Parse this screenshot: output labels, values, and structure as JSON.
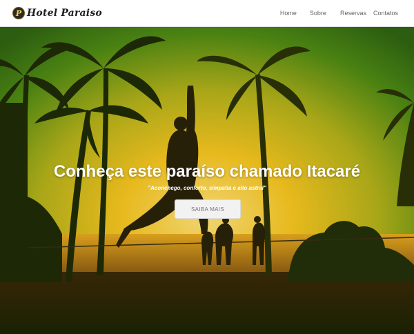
{
  "brand": {
    "name": "Hotel Paraiso",
    "logo_letter": "P"
  },
  "nav": {
    "items": [
      {
        "label": "Home"
      },
      {
        "label": "Sobre"
      },
      {
        "label": "Reservas"
      },
      {
        "label": "Contatos"
      }
    ]
  },
  "hero": {
    "title": "Conheça este paraíso chamado Itacaré",
    "subtitle": "\"Aconchego, conforto, simpatia e alto astral\"",
    "button_label": "SAIBA MAIS"
  },
  "colors": {
    "sky_top": "#2f6b12",
    "sky_glow": "#f4c21c",
    "sea": "#c98a1f",
    "ground": "#1f2a06"
  }
}
